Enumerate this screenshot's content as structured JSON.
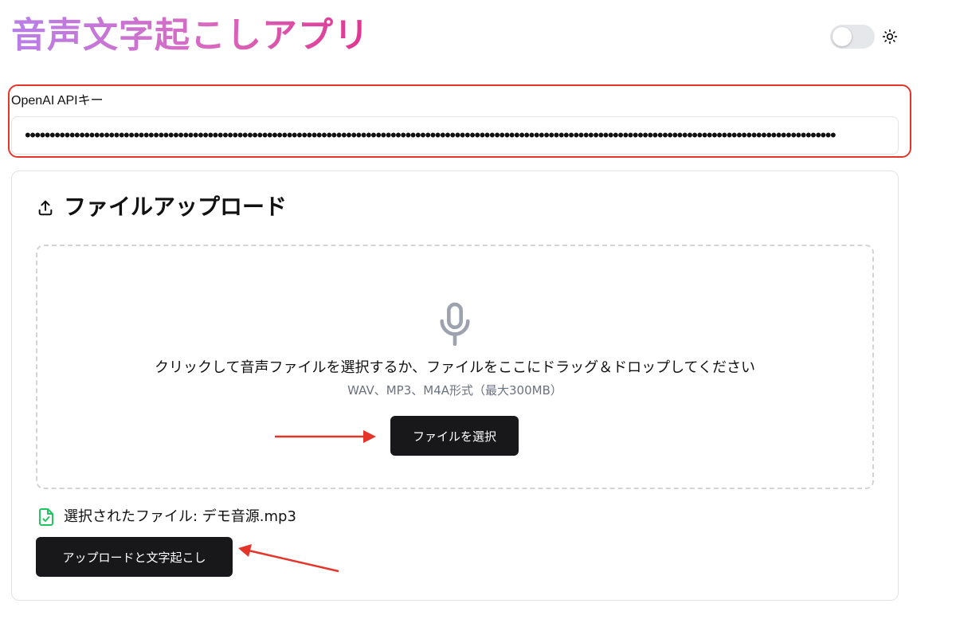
{
  "header": {
    "title": "音声文字起こしアプリ",
    "theme_toggle_icon": "sun-icon"
  },
  "api_key": {
    "label": "OpenAI APIキー",
    "value": "••••••••••••••••••••••••••••••••••••••••••••••••••••••••••••••••••••••••••••••••••••••••••••••••••••••••••••••••••••••••••••••••••••••••••••••••••••••••••••••••••••"
  },
  "upload_card": {
    "title": "ファイルアップロード",
    "title_icon": "upload-icon",
    "dropzone": {
      "icon": "microphone-icon",
      "instruction": "クリックして音声ファイルを選択するか、ファイルをここにドラッグ＆ドロップしてください",
      "formats": "WAV、MP3、M4A形式（最大300MB）",
      "select_button_label": "ファイルを選択"
    },
    "selected_file": {
      "icon": "file-check-icon",
      "text": "選択されたファイル: デモ音源.mp3"
    },
    "upload_button_label": "アップロードと文字起こし"
  },
  "colors": {
    "title_gradient_start": "#b87fe8",
    "title_gradient_end": "#e0358f",
    "annotation_red": "#e5352b",
    "button_dark": "#18181b",
    "file_check_green": "#22c55e",
    "muted_text": "#6b7280"
  }
}
